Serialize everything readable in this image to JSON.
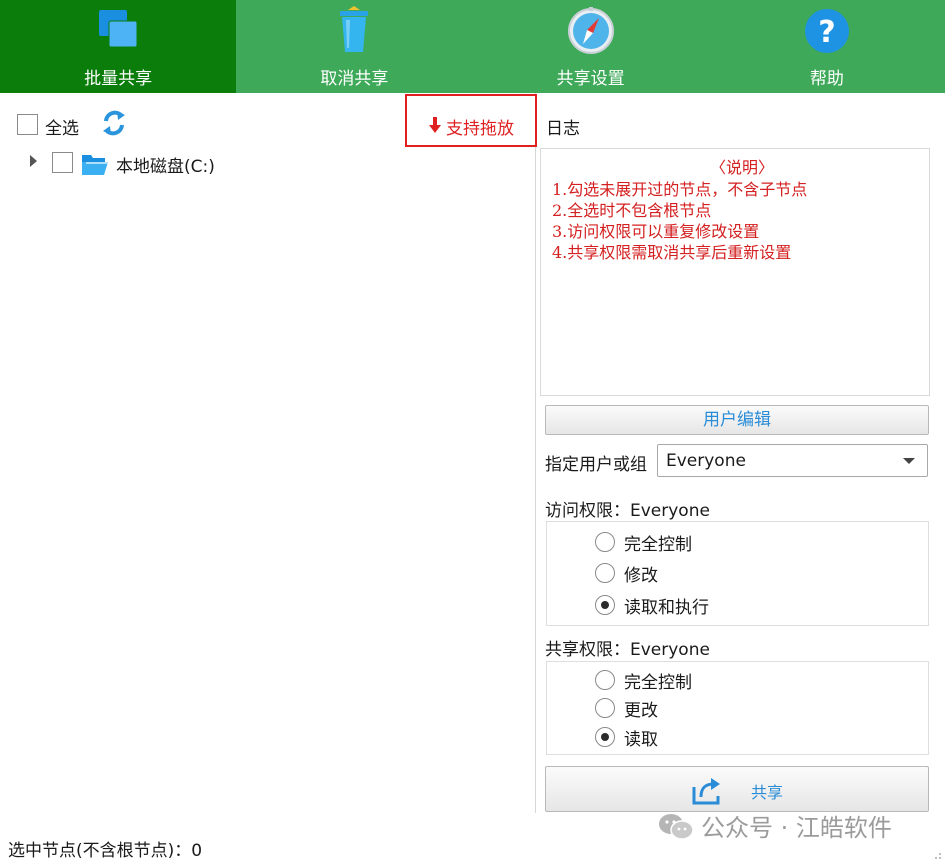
{
  "toolbar": {
    "items": [
      {
        "label": "批量共享",
        "icon": "batch-share-icon",
        "active": true
      },
      {
        "label": "取消共享",
        "icon": "trash-bin-icon",
        "active": false
      },
      {
        "label": "共享设置",
        "icon": "compass-icon",
        "active": false
      },
      {
        "label": "帮助",
        "icon": "help-icon",
        "active": false
      }
    ],
    "colors": {
      "background": "#3ea958",
      "active": "#0b7d0b"
    }
  },
  "left": {
    "select_all": "全选",
    "drag_hint": "支持拖放",
    "tree": [
      {
        "label": "本地磁盘(C:)",
        "icon": "folder-open-icon",
        "checked": false
      }
    ]
  },
  "log": {
    "label": "日志",
    "lines": [
      "〈说明〉",
      "1.勾选未展开过的节点，不含子节点",
      "2.全选时不包含根节点",
      "3.访问权限可以重复修改设置",
      "4.共享权限需取消共享后重新设置"
    ],
    "color": "#d42020"
  },
  "user_edit": "用户编辑",
  "user_select": {
    "label": "指定用户或组",
    "value": "Everyone"
  },
  "access": {
    "label": "访问权限：Everyone",
    "options": [
      {
        "label": "完全控制",
        "checked": false
      },
      {
        "label": "修改",
        "checked": false
      },
      {
        "label": "读取和执行",
        "checked": true
      }
    ]
  },
  "share_perm": {
    "label": "共享权限：Everyone",
    "options": [
      {
        "label": "完全控制",
        "checked": false
      },
      {
        "label": "更改",
        "checked": false
      },
      {
        "label": "读取",
        "checked": true
      }
    ]
  },
  "share_button": "共享",
  "status": "选中节点(不含根节点)：0",
  "watermark": "公众号 · 江皓软件"
}
